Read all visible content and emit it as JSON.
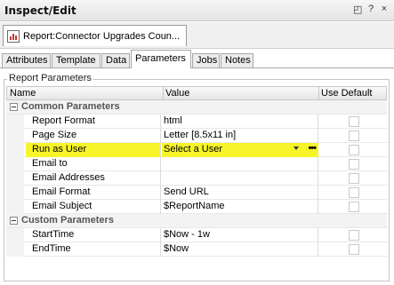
{
  "window": {
    "title": "Inspect/Edit",
    "controls": [
      "◰",
      "?",
      "×"
    ]
  },
  "document_tab": {
    "label": "Report:Connector Upgrades Coun..."
  },
  "tabs": [
    {
      "label": "Attributes",
      "active": false
    },
    {
      "label": "Template",
      "active": false
    },
    {
      "label": "Data",
      "active": false
    },
    {
      "label": "Parameters",
      "active": true
    },
    {
      "label": "Jobs",
      "active": false
    },
    {
      "label": "Notes",
      "active": false
    }
  ],
  "group": {
    "label": "Report Parameters"
  },
  "table": {
    "headers": {
      "name": "Name",
      "value": "Value",
      "use_default": "Use Default"
    },
    "categories": [
      {
        "label": "Common Parameters",
        "rows": [
          {
            "name": "Report Format",
            "value": "html"
          },
          {
            "name": "Page Size",
            "value": "Letter [8.5x11 in]"
          },
          {
            "name": "Run as User",
            "value": "Select a User",
            "highlighted": true
          },
          {
            "name": "Email to",
            "value": ""
          },
          {
            "name": "Email Addresses",
            "value": ""
          },
          {
            "name": "Email Format",
            "value": "Send URL"
          },
          {
            "name": "Email Subject",
            "value": "$ReportName"
          }
        ]
      },
      {
        "label": "Custom Parameters",
        "rows": [
          {
            "name": "StartTime",
            "value": "$Now - 1w"
          },
          {
            "name": "EndTime",
            "value": "$Now"
          }
        ]
      }
    ]
  },
  "colors": {
    "highlight": "#f7f52a",
    "category_bg": "#f3f3f3"
  }
}
